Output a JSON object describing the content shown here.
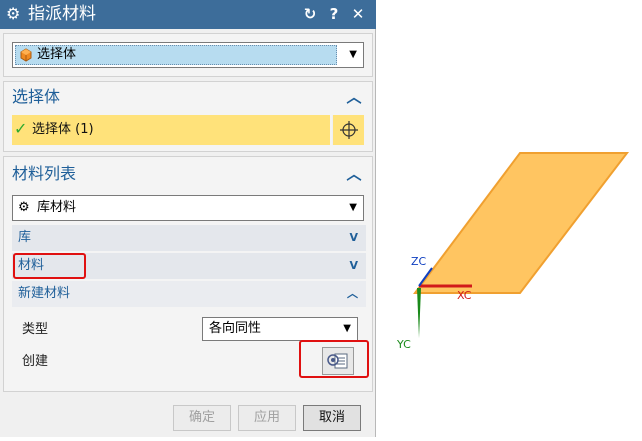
{
  "dialog": {
    "title": "指派材料",
    "top_selector": {
      "value": "选择体"
    },
    "select_body_section": {
      "header": "选择体",
      "selection_label": "选择体 (1)"
    },
    "material_list_section": {
      "header": "材料列表",
      "source": {
        "value": "库材料"
      },
      "library_row": "库",
      "material_row": "材料",
      "new_material": {
        "header": "新建材料",
        "type_label": "类型",
        "type_value": "各向同性",
        "create_label": "创建"
      }
    },
    "buttons": {
      "ok": "确定",
      "apply": "应用",
      "cancel": "取消"
    }
  },
  "viewport": {
    "axes": {
      "zc": "ZC",
      "xc": "XC",
      "yc": "YC"
    },
    "body_color": "#ffc561",
    "body_edge_color": "#f0a030"
  },
  "colors": {
    "titlebar": "#3d6d9a",
    "section_header_text": "#1f5f99",
    "highlight": "#ffe27a",
    "annotation": "#e01010"
  }
}
